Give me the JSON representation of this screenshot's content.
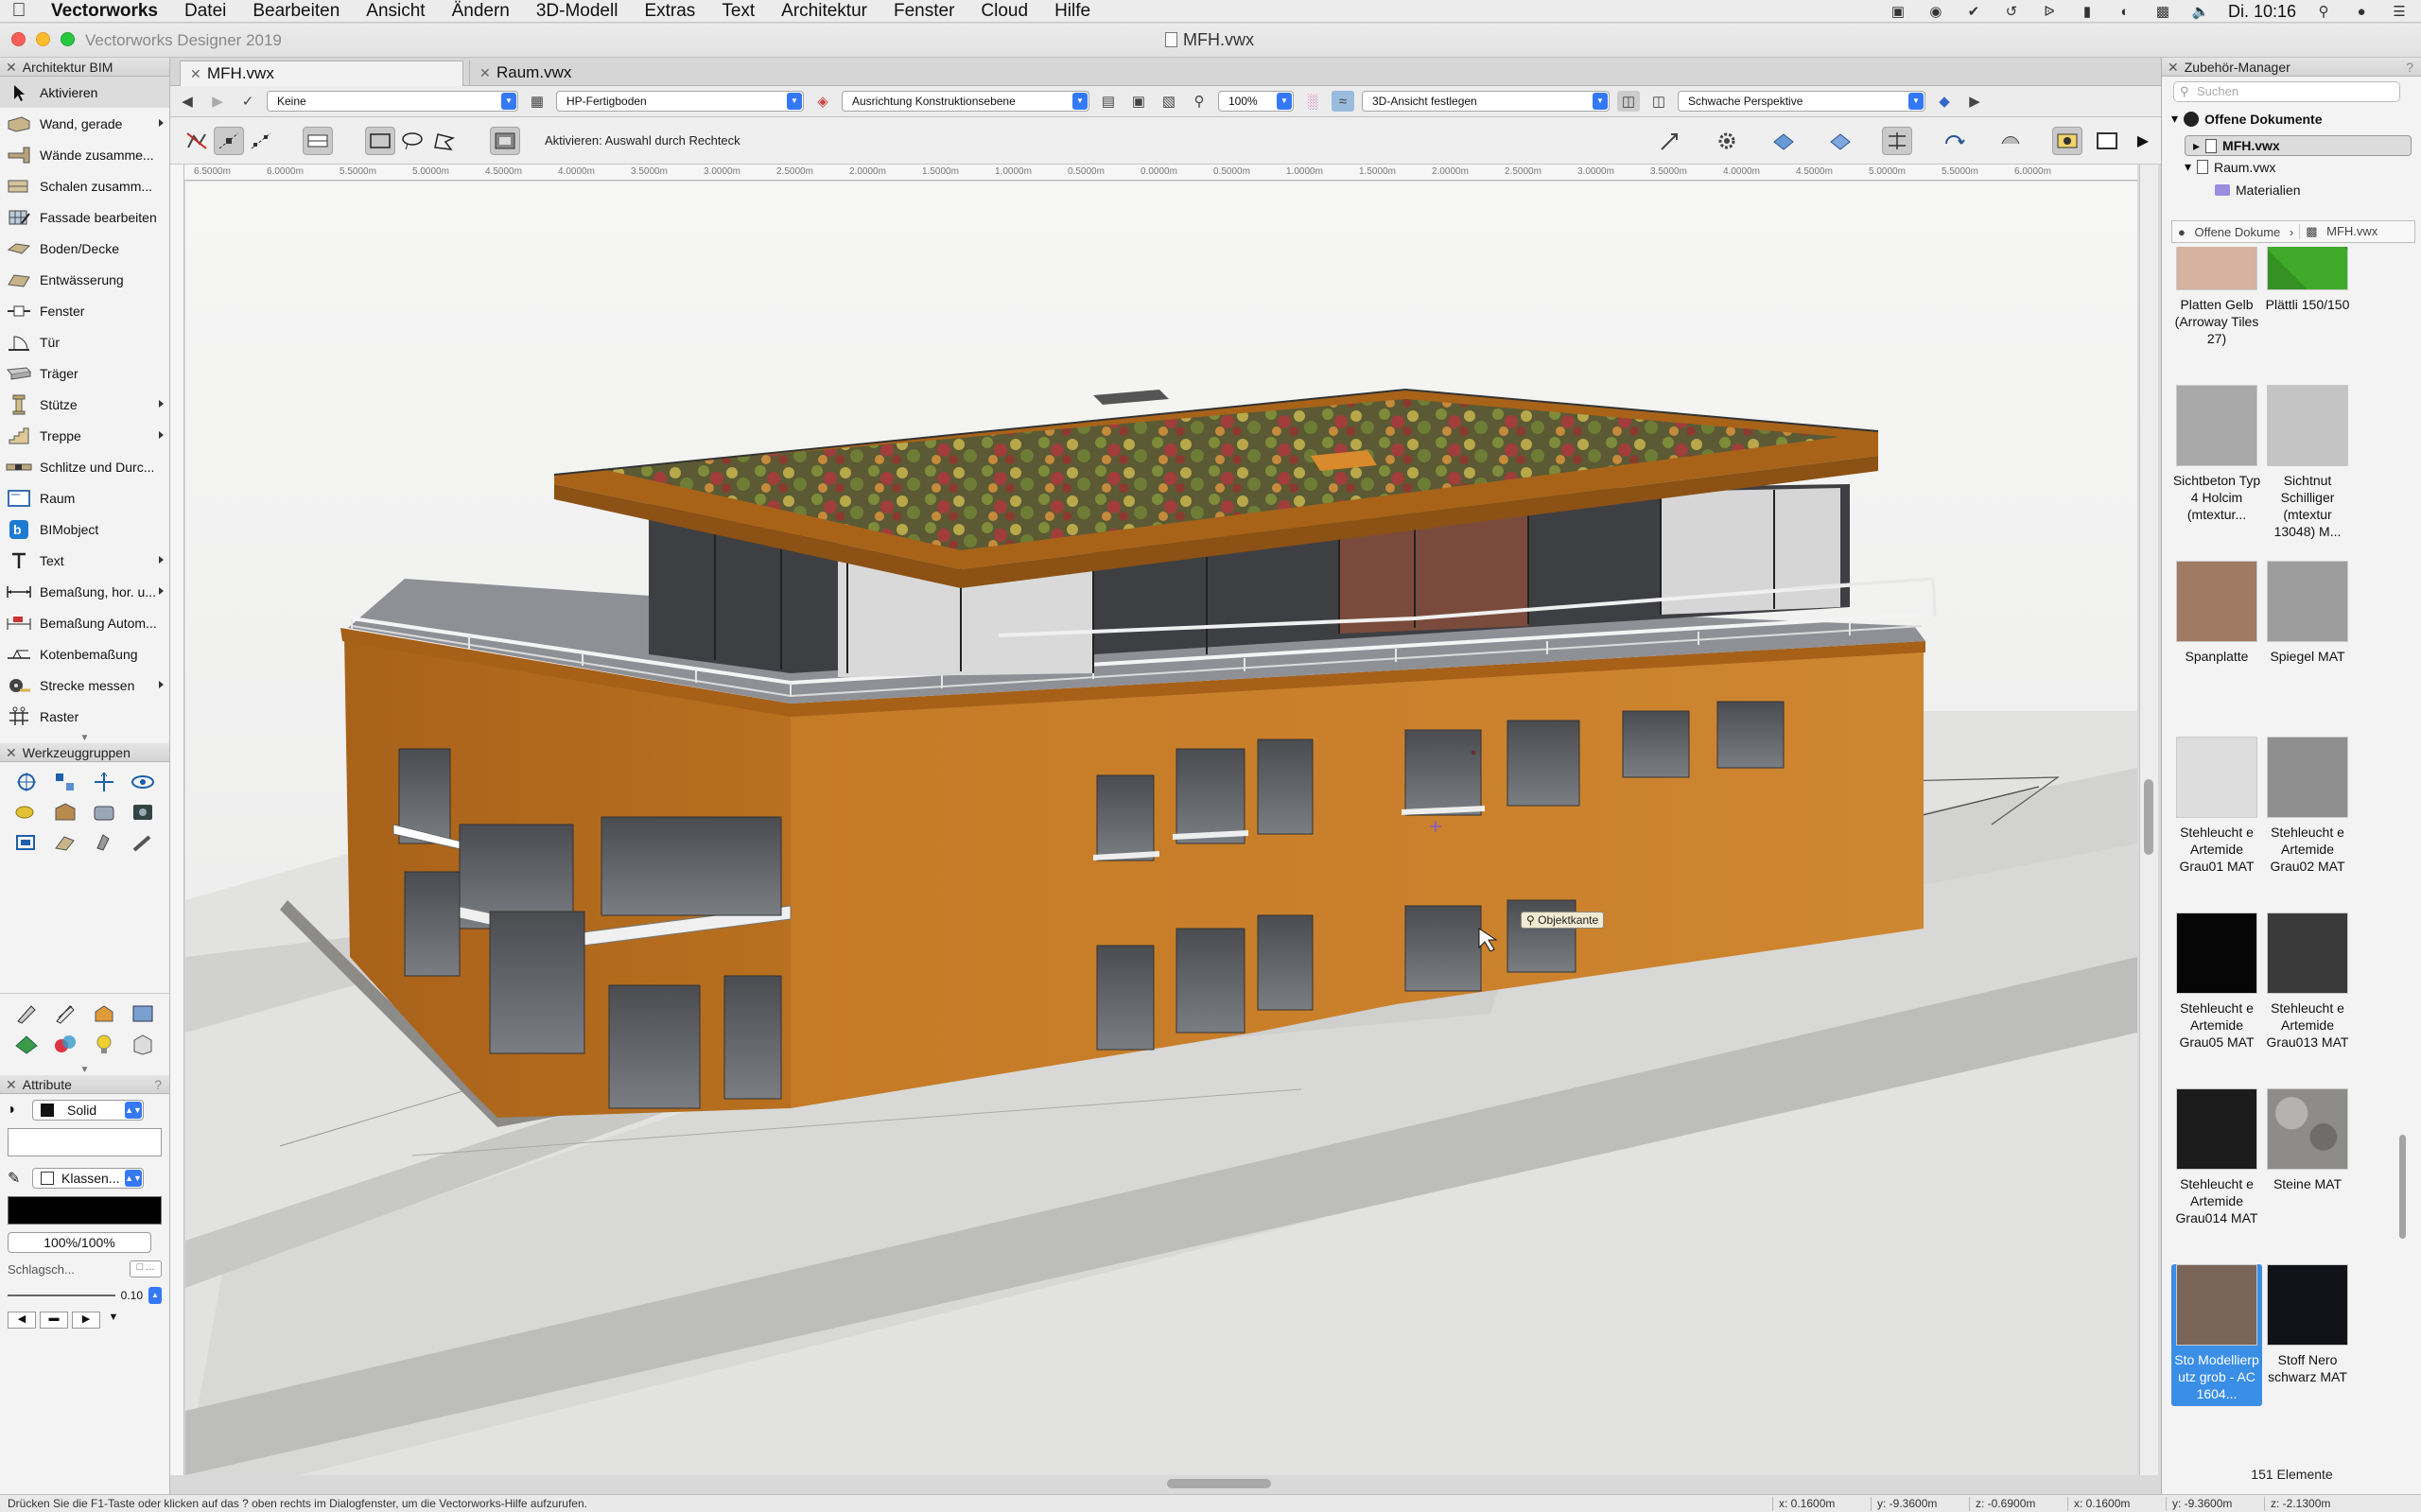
{
  "menubar": {
    "app": "Vectorworks",
    "items": [
      "Datei",
      "Bearbeiten",
      "Ansicht",
      "Ändern",
      "3D-Modell",
      "Extras",
      "Text",
      "Architektur",
      "Fenster",
      "Cloud",
      "Hilfe"
    ],
    "clock": "Di. 10:16"
  },
  "window": {
    "app_title": "Vectorworks Designer 2019",
    "doc_title": "MFH.vwx"
  },
  "tool_palette": {
    "title": "Architektur BIM",
    "items": [
      {
        "label": "Aktivieren"
      },
      {
        "label": "Wand, gerade"
      },
      {
        "label": "Wände zusamme..."
      },
      {
        "label": "Schalen zusamm..."
      },
      {
        "label": "Fassade bearbeiten"
      },
      {
        "label": "Boden/Decke"
      },
      {
        "label": "Entwässerung"
      },
      {
        "label": "Fenster"
      },
      {
        "label": "Tür"
      },
      {
        "label": "Träger"
      },
      {
        "label": "Stütze"
      },
      {
        "label": "Treppe"
      },
      {
        "label": "Schlitze und Durc..."
      },
      {
        "label": "Raum"
      },
      {
        "label": "BIMobject"
      },
      {
        "label": "Text"
      },
      {
        "label": "Bemaßung, hor. u..."
      },
      {
        "label": "Bemaßung Autom..."
      },
      {
        "label": "Kotenbemaßung"
      },
      {
        "label": "Strecke messen"
      },
      {
        "label": "Raster"
      }
    ]
  },
  "tool_sets": {
    "title": "Werkzeuggruppen"
  },
  "attributes": {
    "title": "Attribute",
    "fill_style": "Solid",
    "pen_style": "Klassen...",
    "opacity": "100%/100%",
    "shadow_label": "Schlagsch...",
    "line_weight": "0.10",
    "colors": {
      "fill": "#ffffff",
      "pen": "#000000"
    }
  },
  "tabs": [
    {
      "label": "MFH.vwx"
    },
    {
      "label": "Raum.vwx"
    }
  ],
  "view_bar": {
    "class": "Keine",
    "layer": "HP-Fertigboden",
    "plane": "Ausrichtung Konstruktionsebene",
    "zoom": "100%",
    "view_lock": "3D-Ansicht festlegen",
    "projection": "Schwache Perspektive"
  },
  "mode_bar": {
    "hint": "Aktivieren: Auswahl durch Rechteck"
  },
  "ruler_ticks": [
    "6.5000m",
    "6.0000m",
    "5.5000m",
    "5.0000m",
    "4.5000m",
    "4.0000m",
    "3.5000m",
    "3.0000m",
    "2.5000m",
    "2.0000m",
    "1.5000m",
    "1.0000m",
    "0.5000m",
    "0.0000m",
    "0.5000m",
    "1.0000m",
    "1.5000m",
    "2.0000m",
    "2.5000m",
    "3.0000m",
    "3.5000m",
    "4.0000m",
    "4.5000m",
    "5.0000m",
    "5.5000m",
    "6.0000m"
  ],
  "canvas": {
    "snap_hint": "Objektkante"
  },
  "status": {
    "help": "Drücken Sie die F1-Taste oder klicken auf das ? oben rechts im Dialogfenster, um die Vectorworks-Hilfe aufzurufen.",
    "coords": [
      "x: 0.1600m",
      "y: -9.3600m",
      "z: -0.6900m",
      "x: 0.1600m",
      "y: -9.3600m",
      "z: -2.1300m"
    ]
  },
  "resource_manager": {
    "title": "Zubehör-Manager",
    "search_placeholder": "Suchen",
    "tree": {
      "root": "Offene Dokumente",
      "doc1": "MFH.vwx",
      "doc2": "Raum.vwx",
      "folder": "Materialien"
    },
    "path": {
      "root": "Offene Dokume",
      "doc": "MFH.vwx"
    },
    "resources": [
      {
        "name": "Platten Gelb (Arroway Tiles 27)",
        "color": "#d6b2a0"
      },
      {
        "name": "Plättli 150/150",
        "color": "#3faa2a"
      },
      {
        "name": "Sichtbeton Typ 4 Holcim (mtextur...",
        "color": "#a9a9a9"
      },
      {
        "name": "Sichtnut Schilliger (mtextur 13048) M...",
        "color": "#c4c4c4"
      },
      {
        "name": "Spanplatte",
        "color": "#a07a62"
      },
      {
        "name": "Spiegel MAT",
        "color": "#9d9d9d"
      },
      {
        "name": "Stehleucht e Artemide Grau01 MAT",
        "color": "#dddddd"
      },
      {
        "name": "Stehleucht e Artemide Grau02 MAT",
        "color": "#8f8f8f"
      },
      {
        "name": "Stehleucht e Artemide Grau05 MAT",
        "color": "#060606"
      },
      {
        "name": "Stehleucht e Artemide Grau013 MAT",
        "color": "#3a3a3a"
      },
      {
        "name": "Stehleucht e Artemide Grau014 MAT",
        "color": "#1c1c1c"
      },
      {
        "name": "Steine MAT",
        "color": "#8e8c88"
      },
      {
        "name": "Sto Modellierp utz grob - AC 1604...",
        "color": "#7a6558"
      },
      {
        "name": "Stoff Nero schwarz MAT",
        "color": "#111318"
      }
    ],
    "count": "151 Elemente"
  },
  "colors": {
    "facade": "#b5691c",
    "accent": "#3478f6"
  }
}
